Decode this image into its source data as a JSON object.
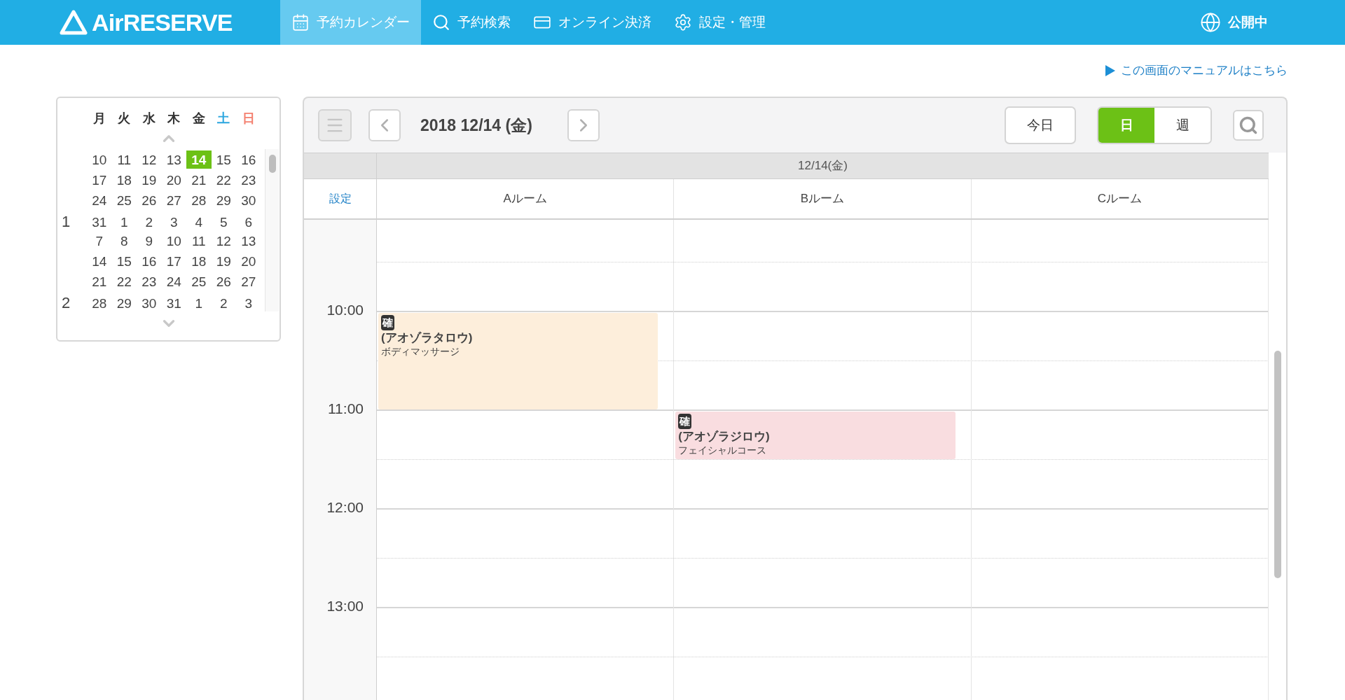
{
  "header": {
    "logo": "AirRESERVE",
    "nav": [
      {
        "label": "予約カレンダー",
        "selected": true,
        "kind": "calendar"
      },
      {
        "label": "予約検索",
        "selected": false,
        "kind": "search"
      },
      {
        "label": "オンライン決済",
        "selected": false,
        "kind": "card"
      },
      {
        "label": "設定・管理",
        "selected": false,
        "kind": "settings"
      }
    ],
    "status": "公開中"
  },
  "manual_link": "この画面のマニュアルはこちら",
  "mini_calendar": {
    "weekdays": [
      {
        "label": "月",
        "kind": "weekday"
      },
      {
        "label": "火",
        "kind": "weekday"
      },
      {
        "label": "水",
        "kind": "weekday"
      },
      {
        "label": "木",
        "kind": "weekday"
      },
      {
        "label": "金",
        "kind": "weekday"
      },
      {
        "label": "土",
        "kind": "saturday"
      },
      {
        "label": "日",
        "kind": "sunday"
      }
    ],
    "weeks": [
      {
        "days": [
          {
            "label": "10",
            "selected": false
          },
          {
            "label": "11",
            "selected": false
          },
          {
            "label": "12",
            "selected": false
          },
          {
            "label": "13",
            "selected": false
          },
          {
            "label": "14",
            "selected": true
          },
          {
            "label": "15",
            "selected": false
          },
          {
            "label": "16",
            "selected": false
          }
        ]
      },
      {
        "days": [
          {
            "label": "17",
            "selected": false
          },
          {
            "label": "18",
            "selected": false
          },
          {
            "label": "19",
            "selected": false
          },
          {
            "label": "20",
            "selected": false
          },
          {
            "label": "21",
            "selected": false
          },
          {
            "label": "22",
            "selected": false
          },
          {
            "label": "23",
            "selected": false
          }
        ]
      },
      {
        "days": [
          {
            "label": "24",
            "selected": false
          },
          {
            "label": "25",
            "selected": false
          },
          {
            "label": "26",
            "selected": false
          },
          {
            "label": "27",
            "selected": false
          },
          {
            "label": "28",
            "selected": false
          },
          {
            "label": "29",
            "selected": false
          },
          {
            "label": "30",
            "selected": false
          }
        ]
      },
      {
        "month": "1",
        "days": [
          {
            "label": "31",
            "selected": false
          },
          {
            "label": "1",
            "selected": false
          },
          {
            "label": "2",
            "selected": false
          },
          {
            "label": "3",
            "selected": false
          },
          {
            "label": "4",
            "selected": false
          },
          {
            "label": "5",
            "selected": false
          },
          {
            "label": "6",
            "selected": false
          }
        ]
      },
      {
        "days": [
          {
            "label": "7",
            "selected": false
          },
          {
            "label": "8",
            "selected": false
          },
          {
            "label": "9",
            "selected": false
          },
          {
            "label": "10",
            "selected": false
          },
          {
            "label": "11",
            "selected": false
          },
          {
            "label": "12",
            "selected": false
          },
          {
            "label": "13",
            "selected": false
          }
        ]
      },
      {
        "days": [
          {
            "label": "14",
            "selected": false
          },
          {
            "label": "15",
            "selected": false
          },
          {
            "label": "16",
            "selected": false
          },
          {
            "label": "17",
            "selected": false
          },
          {
            "label": "18",
            "selected": false
          },
          {
            "label": "19",
            "selected": false
          },
          {
            "label": "20",
            "selected": false
          }
        ]
      },
      {
        "days": [
          {
            "label": "21",
            "selected": false
          },
          {
            "label": "22",
            "selected": false
          },
          {
            "label": "23",
            "selected": false
          },
          {
            "label": "24",
            "selected": false
          },
          {
            "label": "25",
            "selected": false
          },
          {
            "label": "26",
            "selected": false
          },
          {
            "label": "27",
            "selected": false
          }
        ]
      },
      {
        "month": "2",
        "days": [
          {
            "label": "28",
            "selected": false
          },
          {
            "label": "29",
            "selected": false
          },
          {
            "label": "30",
            "selected": false
          },
          {
            "label": "31",
            "selected": false
          },
          {
            "label": "1",
            "selected": false
          },
          {
            "label": "2",
            "selected": false
          },
          {
            "label": "3",
            "selected": false
          }
        ]
      }
    ]
  },
  "toolbar": {
    "date": "2018 12/14 (金)",
    "today": "今日",
    "views": [
      {
        "label": "日",
        "selected": true
      },
      {
        "label": "週",
        "selected": false
      }
    ]
  },
  "schedule": {
    "date_header": "12/14(金)",
    "settings_link": "設定",
    "rooms": [
      "Aルーム",
      "Bルーム",
      "Cルーム"
    ],
    "times": [
      {
        "label": "10:00",
        "cells": [
          {
            "full_hour": true,
            "badge": "確",
            "name": "(アオゾラタロウ)",
            "service": "ボディマッサージ",
            "color": "#fdeedb"
          },
          {},
          {}
        ]
      },
      {
        "label": "11:00",
        "cells": [
          {},
          {
            "full_hour": false,
            "badge": "確",
            "name": "(アオゾラジロウ)",
            "service": "フェイシャルコース",
            "color": "#f9dde0"
          },
          {}
        ]
      },
      {
        "label": "12:00"
      },
      {
        "label": "13:00"
      }
    ]
  }
}
